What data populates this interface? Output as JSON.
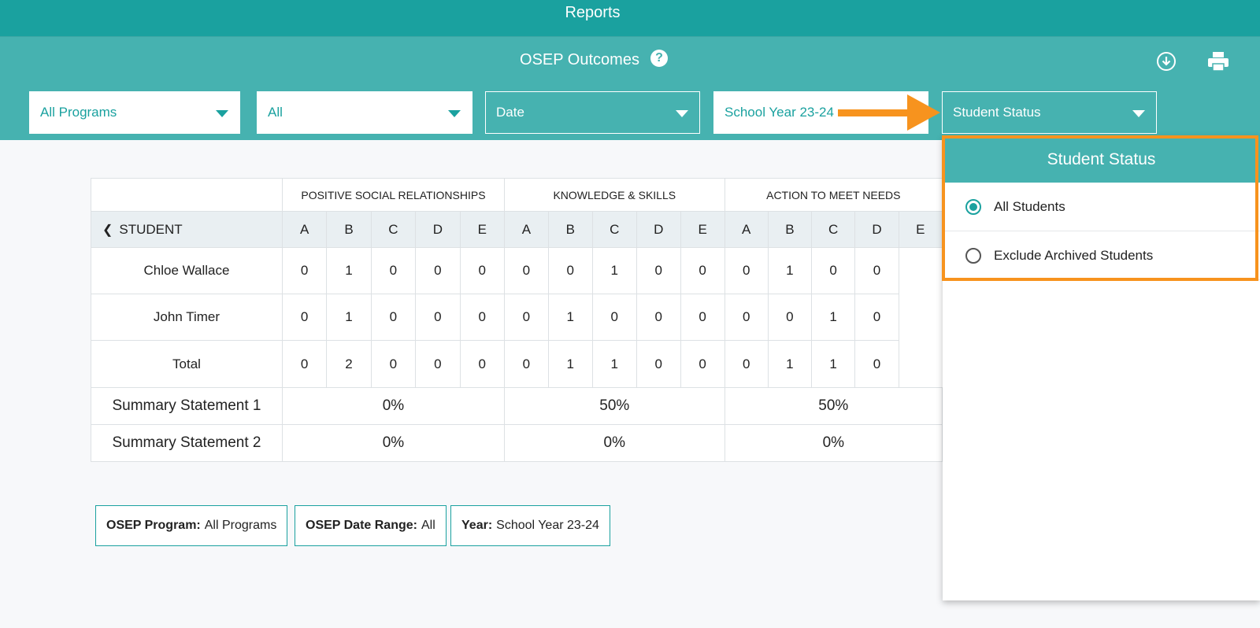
{
  "header": {
    "title": "Reports"
  },
  "subheader": {
    "title": "OSEP Outcomes",
    "help_glyph": "?"
  },
  "filters": {
    "program": "All Programs",
    "range": "All",
    "date": "Date",
    "year": "School Year 23-24",
    "status": "Student Status"
  },
  "table": {
    "groups": [
      "POSITIVE SOCIAL RELATIONSHIPS",
      "KNOWLEDGE & SKILLS",
      "ACTION TO MEET NEEDS"
    ],
    "student_header": "STUDENT",
    "letters": [
      "A",
      "B",
      "C",
      "D",
      "E"
    ],
    "rows": [
      {
        "name": "Chloe Wallace",
        "values": [
          "0",
          "1",
          "0",
          "0",
          "0",
          "0",
          "0",
          "1",
          "0",
          "0",
          "0",
          "1",
          "0",
          "0"
        ]
      },
      {
        "name": "John Timer",
        "values": [
          "0",
          "1",
          "0",
          "0",
          "0",
          "0",
          "1",
          "0",
          "0",
          "0",
          "0",
          "0",
          "1",
          "0"
        ]
      }
    ],
    "total": {
      "name": "Total",
      "values": [
        "0",
        "2",
        "0",
        "0",
        "0",
        "0",
        "1",
        "1",
        "0",
        "0",
        "0",
        "1",
        "1",
        "0"
      ]
    },
    "summary1": {
      "name": "Summary Statement 1",
      "values": [
        "0%",
        "50%",
        "50%"
      ]
    },
    "summary2": {
      "name": "Summary Statement 2",
      "values": [
        "0%",
        "0%",
        "0%"
      ]
    }
  },
  "chips": [
    {
      "label": "OSEP Program:",
      "value": "All Programs"
    },
    {
      "label": "OSEP Date Range:",
      "value": "All"
    },
    {
      "label": "Year:",
      "value": "School Year 23-24"
    }
  ],
  "dropdown": {
    "title": "Student Status",
    "options": [
      {
        "label": "All Students",
        "selected": true
      },
      {
        "label": "Exclude Archived Students",
        "selected": false
      }
    ]
  },
  "colors": {
    "primary": "#1aa19f",
    "secondary": "#46b2b0",
    "highlight": "#f7931e"
  }
}
